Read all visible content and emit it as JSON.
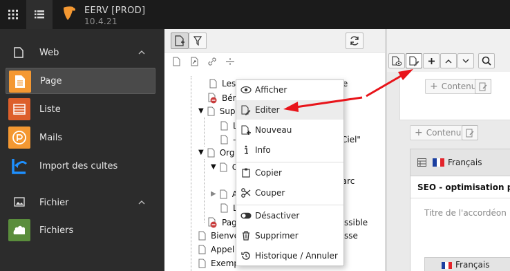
{
  "topbar": {
    "app_title": "EERV [PROD]",
    "app_version": "10.4.21",
    "icons": [
      "app-grid-icon",
      "list-icon",
      "typo3-logo-icon"
    ]
  },
  "sidebar": {
    "groups": [
      {
        "label": "Web",
        "icon": "file-icon",
        "expanded": true
      },
      {
        "label": "Fichier",
        "icon": "image-icon",
        "expanded": true
      }
    ],
    "modules": [
      {
        "label": "Page",
        "icon": "page-module-icon",
        "color": "#f49832",
        "active": true
      },
      {
        "label": "Liste",
        "icon": "list-module-icon",
        "color": "#dd5f2b",
        "active": false
      },
      {
        "label": "Mails",
        "icon": "mails-module-icon",
        "color": "#f49832",
        "active": false
      },
      {
        "label": "Import des cultes",
        "icon": "import-arrow-icon",
        "color": "#1e90ff",
        "active": false
      },
      {
        "label": "Fichiers",
        "icon": "files-module-icon",
        "color": "#5a8d3c",
        "active": false
      }
    ]
  },
  "tree": {
    "rows": [
      "Les",
      "isse",
      "Bén",
      "Sup",
      "L",
      "-",
      "Ciel\"",
      "Org",
      "C",
      "l parc",
      "A",
      "L",
      "Pag",
      "ssible",
      "Bienve",
      "sse",
      "Appel",
      "Exempl"
    ]
  },
  "context_menu": {
    "items": [
      {
        "label": "Afficher",
        "icon": "eye-icon",
        "highlighted": false
      },
      {
        "label": "Editer",
        "icon": "edit-pencil-icon",
        "highlighted": true
      },
      {
        "label": "Nouveau",
        "icon": "new-page-icon",
        "highlighted": false
      },
      {
        "label": "Info",
        "icon": "info-icon",
        "highlighted": false
      },
      {
        "label": "Copier",
        "icon": "copy-icon",
        "highlighted": false
      },
      {
        "label": "Couper",
        "icon": "scissors-icon",
        "highlighted": false
      },
      {
        "label": "Désactiver",
        "icon": "toggle-icon",
        "highlighted": false
      },
      {
        "label": "Supprimer",
        "icon": "trash-icon",
        "highlighted": false
      },
      {
        "label": "Historique / Annuler",
        "icon": "history-icon",
        "highlighted": false
      }
    ]
  },
  "content": {
    "add_content_label": "Contenu",
    "language": "Français",
    "element_title": "SEO - optimisation p",
    "accordion_placeholder": "Titre de l'accordéon",
    "language_2": "Français"
  },
  "colors": {
    "accent": "#f49832",
    "arrow": "#e8141a",
    "topbar": "#1b1b1b",
    "sidebar": "#2c2c2c"
  }
}
